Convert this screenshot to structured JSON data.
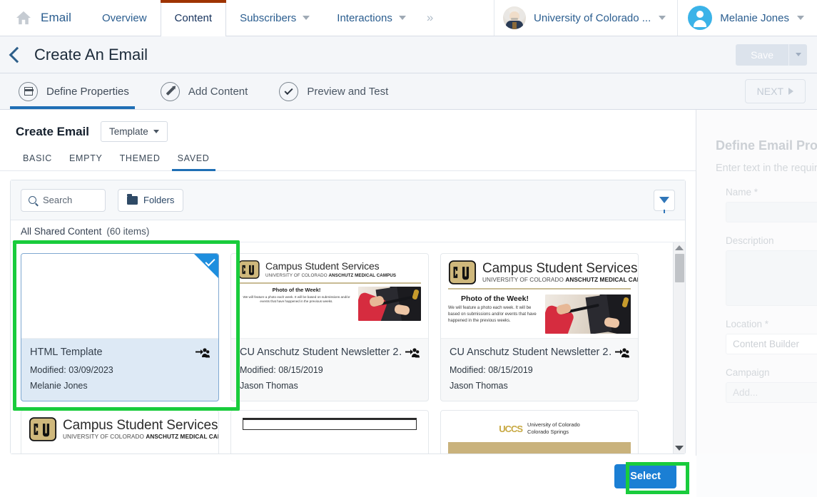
{
  "topnav": {
    "home_icon": "home-icon",
    "app_name": "Email",
    "items": [
      {
        "label": "Overview",
        "has_caret": false,
        "active": false
      },
      {
        "label": "Content",
        "has_caret": false,
        "active": true
      },
      {
        "label": "Subscribers",
        "has_caret": true,
        "active": false
      },
      {
        "label": "Interactions",
        "has_caret": true,
        "active": false
      }
    ],
    "overflow": "»",
    "org_name": "University of Colorado ...",
    "org_avatar": "einstein-avatar",
    "user_name": "Melanie Jones",
    "user_avatar": "user-avatar"
  },
  "titlebar": {
    "back_icon": "back-chevron-icon",
    "title": "Create An Email",
    "save_label": "Save",
    "save_caret_icon": "chevron-down-icon"
  },
  "stepbar": {
    "steps": [
      {
        "label": "Define Properties",
        "icon": "layout-icon",
        "active": true
      },
      {
        "label": "Add Content",
        "icon": "pencil-icon",
        "active": false
      },
      {
        "label": "Preview and Test",
        "icon": "check-circle-icon",
        "active": false
      }
    ],
    "next_label": "NEXT",
    "next_icon": "play-arrow-icon"
  },
  "modal": {
    "title": "Create Email",
    "template_button": "Template",
    "tabs": [
      {
        "label": "BASIC",
        "active": false
      },
      {
        "label": "EMPTY",
        "active": false
      },
      {
        "label": "THEMED",
        "active": false
      },
      {
        "label": "SAVED",
        "active": true
      }
    ],
    "toolbar": {
      "search_placeholder": "Search",
      "search_icon": "search-icon",
      "folders_label": "Folders",
      "folders_icon": "folder-icon",
      "filter_icon": "filter-funnel-icon"
    },
    "breadcrumb": {
      "path": "All Shared Content",
      "count": "(60 items)"
    },
    "cards": [
      {
        "title": "HTML Template",
        "modified": "Modified: 03/09/2023",
        "owner": "Melanie Jones",
        "selected": true,
        "share_icon": "shared-users-icon",
        "thumb": "blank-template"
      },
      {
        "title": "CU Anschutz Student Newsletter 2…",
        "modified": "Modified: 08/15/2019",
        "owner": "Jason Thomas",
        "selected": false,
        "share_icon": "shared-users-icon",
        "thumb": "cu-newsletter-small"
      },
      {
        "title": "CU Anschutz Student Newsletter 2…",
        "modified": "Modified: 08/15/2019",
        "owner": "Jason Thomas",
        "selected": false,
        "share_icon": "shared-users-icon",
        "thumb": "cu-newsletter-large"
      }
    ],
    "cards_row2": [
      {
        "thumb": "cu-newsletter-small"
      },
      {
        "thumb": "blank-doc"
      },
      {
        "thumb": "uccs-newsletter"
      }
    ],
    "thumb_text": {
      "cu_brand": "Campus Student Services",
      "cu_sub_prefix": "UNIVERSITY OF COLORADO ",
      "cu_sub_bold": "ANSCHUTZ MEDICAL CAMPUS",
      "cu_logo_text": "CU",
      "photo_heading": "Photo of the Week!",
      "photo_blurb": "We will feature a photo each week. It will be based on submissions and/or events that have happened in the previous weeks.",
      "uccs_mark": "UCCS",
      "uccs_line1": "University of Colorado",
      "uccs_line2": "Colorado Springs"
    },
    "scrollbar": {
      "up_icon": "scroll-up-arrow-icon",
      "down_icon": "scroll-down-arrow-icon"
    },
    "select_label": "Select"
  },
  "background_panel": {
    "heading": "Define Email Prop",
    "subtext": "Enter text in the require",
    "fields": [
      {
        "label": "Name *",
        "value": ""
      },
      {
        "label": "Description",
        "value": ""
      },
      {
        "label": "Location *",
        "value": "Content Builder"
      },
      {
        "label": "Campaign",
        "value": "Add..."
      }
    ]
  },
  "colors": {
    "accent_blue": "#1b7fd4",
    "nav_active_bar": "#9e3300",
    "step_active_bar": "#1f6fb5",
    "highlight_green": "#19cc3c",
    "selected_card_bg": "#dde9f5"
  }
}
